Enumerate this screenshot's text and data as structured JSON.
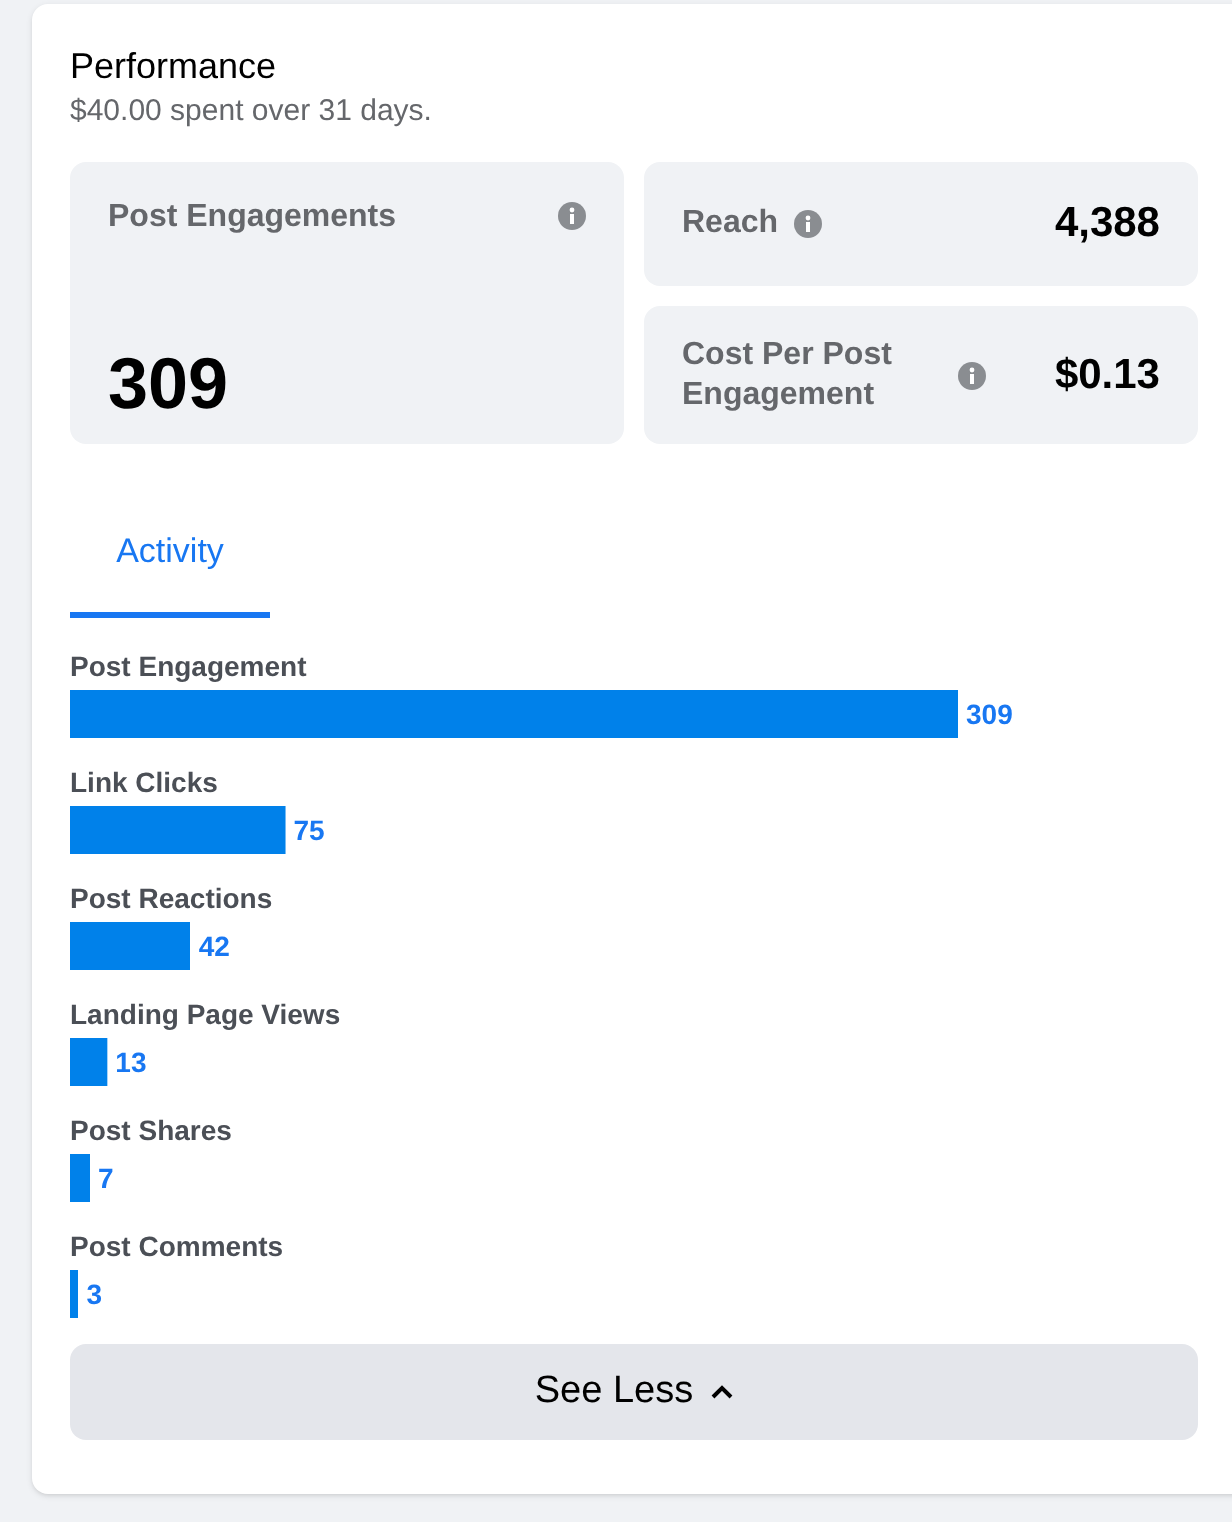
{
  "header": {
    "title": "Performance",
    "subtitle": "$40.00 spent over 31 days."
  },
  "metrics": [
    {
      "label": "Post Engagements",
      "value": "309",
      "kind": "large"
    },
    {
      "label": "Reach",
      "value": "4,388",
      "kind": "compact"
    },
    {
      "label": "Cost Per Post Engagement",
      "value": "$0.13",
      "kind": "compact"
    }
  ],
  "tabs": [
    {
      "label": "Activity",
      "selected": true
    }
  ],
  "activity": {
    "chart_data": {
      "type": "bar",
      "orientation": "horizontal",
      "categories": [
        "Post Engagement",
        "Link Clicks",
        "Post Reactions",
        "Landing Page Views",
        "Post Shares",
        "Post Comments"
      ],
      "series": [
        {
          "color": "#0081ea",
          "values": [
            309,
            75,
            42,
            13,
            7,
            3
          ]
        }
      ],
      "data_labels": true
    }
  },
  "see_less_button": {
    "label": "See Less"
  }
}
